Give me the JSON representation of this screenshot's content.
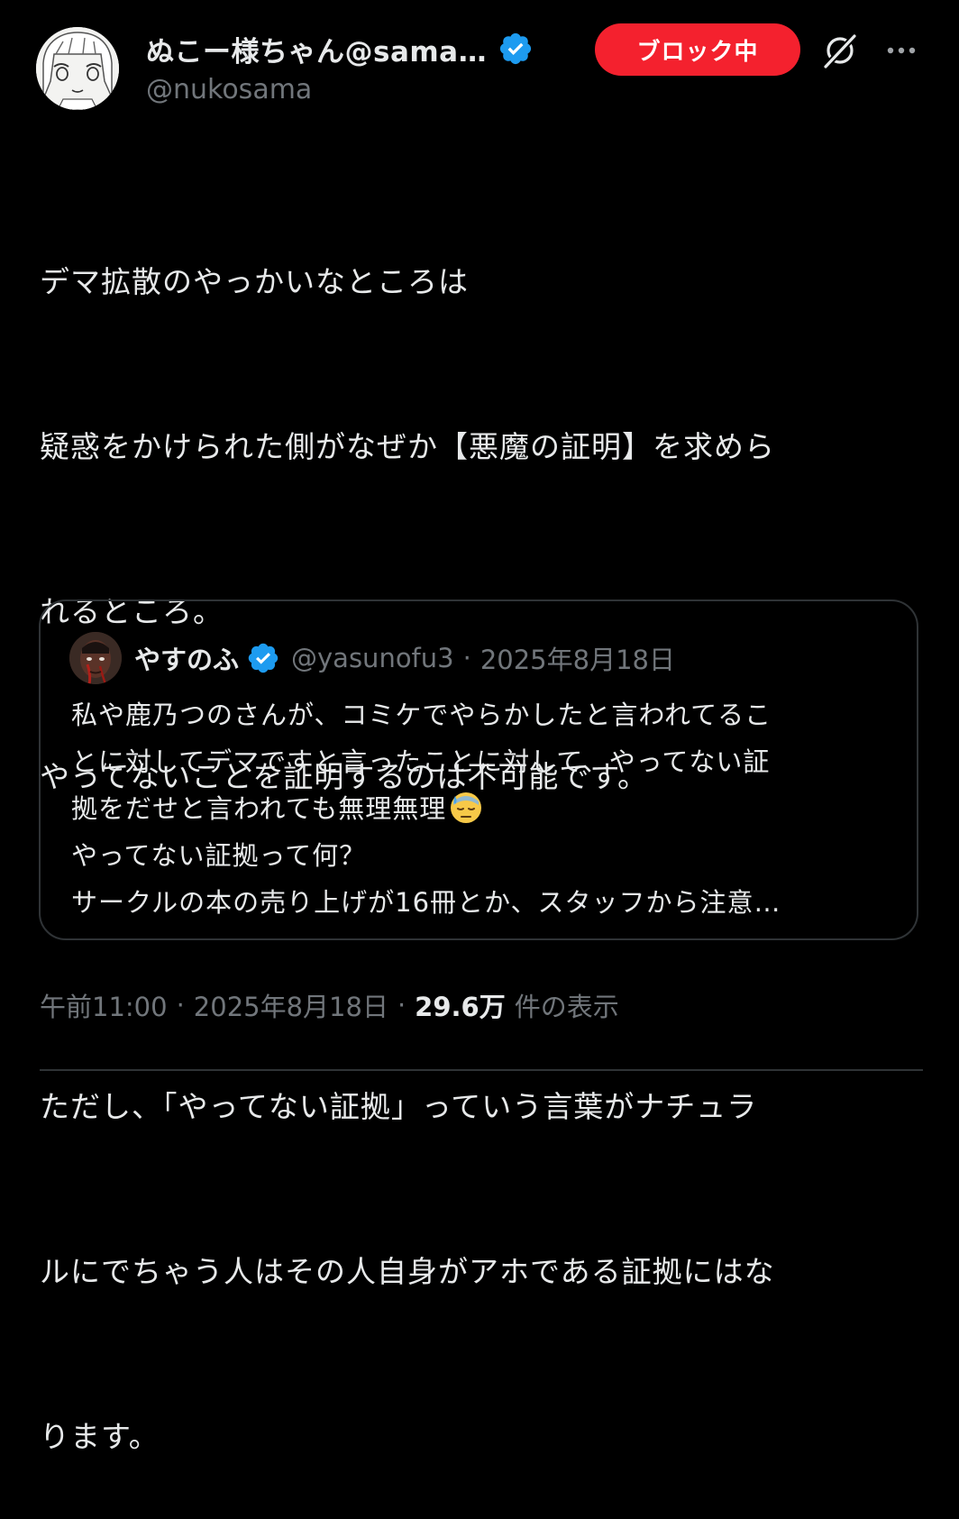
{
  "author": {
    "display_name": "ぬこー様ちゃん@sama…",
    "handle": "@nukosama",
    "verified": true
  },
  "actions": {
    "blocked_label": "ブロック中",
    "grok_icon": "grok-icon",
    "more_icon": "more-icon"
  },
  "tweet": {
    "lines": [
      "デマ拡散のやっかいなところは",
      "疑惑をかけられた側がなぜか【悪魔の証明】を求めら",
      "れるところ。",
      "やってないことを証明するのは不可能です。",
      "",
      "ただし、「やってない証拠」っていう言葉がナチュラ",
      "ルにでちゃう人はその人自身がアホである証拠にはな",
      "ります。"
    ]
  },
  "quote": {
    "name": "やすのふ",
    "handle": "@yasunofu3",
    "separator": "·",
    "date": "2025年8月18日",
    "lines": [
      "私や鹿乃つのさんが、コミケでやらかしたと言われてるこ",
      "とに対してデマですと言ったことに対して、やってない証",
      "拠をだせと言われても無理無理",
      "やってない証拠って何？",
      "サークルの本の売り上げが16冊とか、スタッフから注意…"
    ],
    "emoji": "downcast-face-with-sweat-emoji"
  },
  "meta": {
    "time": "午前11:00",
    "separator": "·",
    "date": "2025年8月18日",
    "views_count": "29.6万",
    "views_label": "件の表示"
  },
  "colors": {
    "background": "#000000",
    "text": "#e7e9ea",
    "muted": "#71767b",
    "border": "#2f3336",
    "verified_blue": "#1d9bf0",
    "blocked_red": "#f4212e"
  }
}
